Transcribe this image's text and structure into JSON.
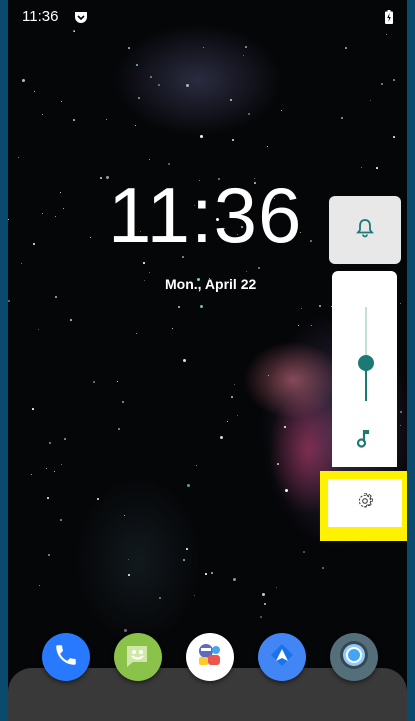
{
  "status_bar": {
    "time": "11:36",
    "app_icon": "pocket-icon",
    "battery_icon": "battery-charging-icon"
  },
  "lock_screen": {
    "clock": "11:36",
    "date": "Mon., April 22"
  },
  "volume_panel": {
    "ringer_icon": "bell-icon",
    "media_level": 0.4,
    "media_icon": "music-note-icon",
    "settings_icon": "gear-icon",
    "accent_color": "#1b7a74",
    "highlight_color": "#fff200"
  },
  "dock": {
    "apps": [
      {
        "icon": "phone-icon",
        "color": "#2979ff"
      },
      {
        "icon": "messages-icon",
        "color": "#8bc34a"
      },
      {
        "icon": "duo-icon",
        "color": "#ffffff"
      },
      {
        "icon": "maps-icon",
        "color": "#4285f4"
      },
      {
        "icon": "camera-icon",
        "color": "#546e7a"
      }
    ]
  }
}
